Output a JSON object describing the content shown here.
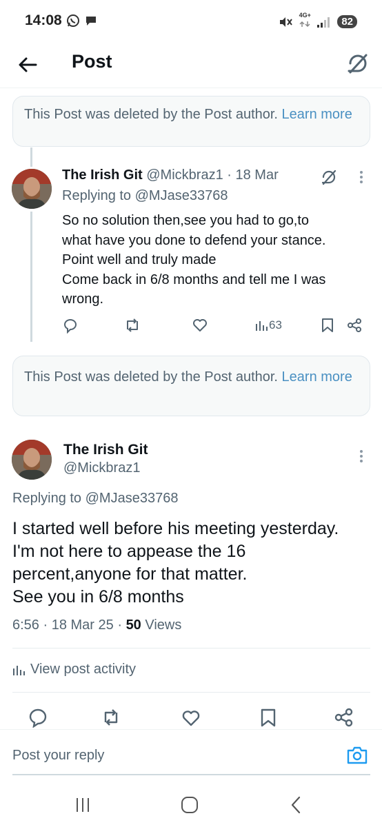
{
  "status_bar": {
    "time": "14:08",
    "network": "4G+",
    "battery": "82"
  },
  "header": {
    "title": "Post"
  },
  "deleted_notice_1": {
    "text": "This Post was deleted by the Post author. ",
    "link": "Learn more"
  },
  "reply": {
    "author_name": "The Irish Git",
    "handle": "@Mickbraz1",
    "separator": "·",
    "date": "18 Mar",
    "replying_prefix": "Replying to ",
    "replying_to": "@MJase33768",
    "lines": [
      "So no solution then,see you had to go,to",
      "what have you done to defend your stance.",
      "Point well and truly made",
      "Come back in 6/8 months and tell me I was",
      "wrong."
    ],
    "views_count": "63"
  },
  "deleted_notice_2": {
    "text": "This Post was deleted by the Post author. ",
    "link": "Learn more"
  },
  "main_post": {
    "author_name": "The Irish Git",
    "handle": "@Mickbraz1",
    "replying_prefix": "Replying to ",
    "replying_to": "@MJase33768",
    "lines": [
      "I started well before his meeting yesterday.",
      "I'm not here to appease the 16",
      "percent,anyone for that matter.",
      "See you in 6/8 months"
    ],
    "time": "6:56",
    "date": "18 Mar 25",
    "views_count": "50",
    "views_label": " Views",
    "view_activity": "View post activity"
  },
  "compose": {
    "placeholder": "Post your reply"
  },
  "colors": {
    "link": "#4a90c2",
    "muted": "#536471",
    "text": "#0f1419",
    "border": "#e1e8ed",
    "accent": "#1d9bf0"
  },
  "icons": [
    "back-arrow-icon",
    "grok-icon",
    "reply-icon",
    "repost-icon",
    "like-icon",
    "views-icon",
    "bookmark-icon",
    "share-icon",
    "more-icon",
    "camera-icon",
    "recent-apps-icon",
    "home-icon",
    "back-icon"
  ]
}
